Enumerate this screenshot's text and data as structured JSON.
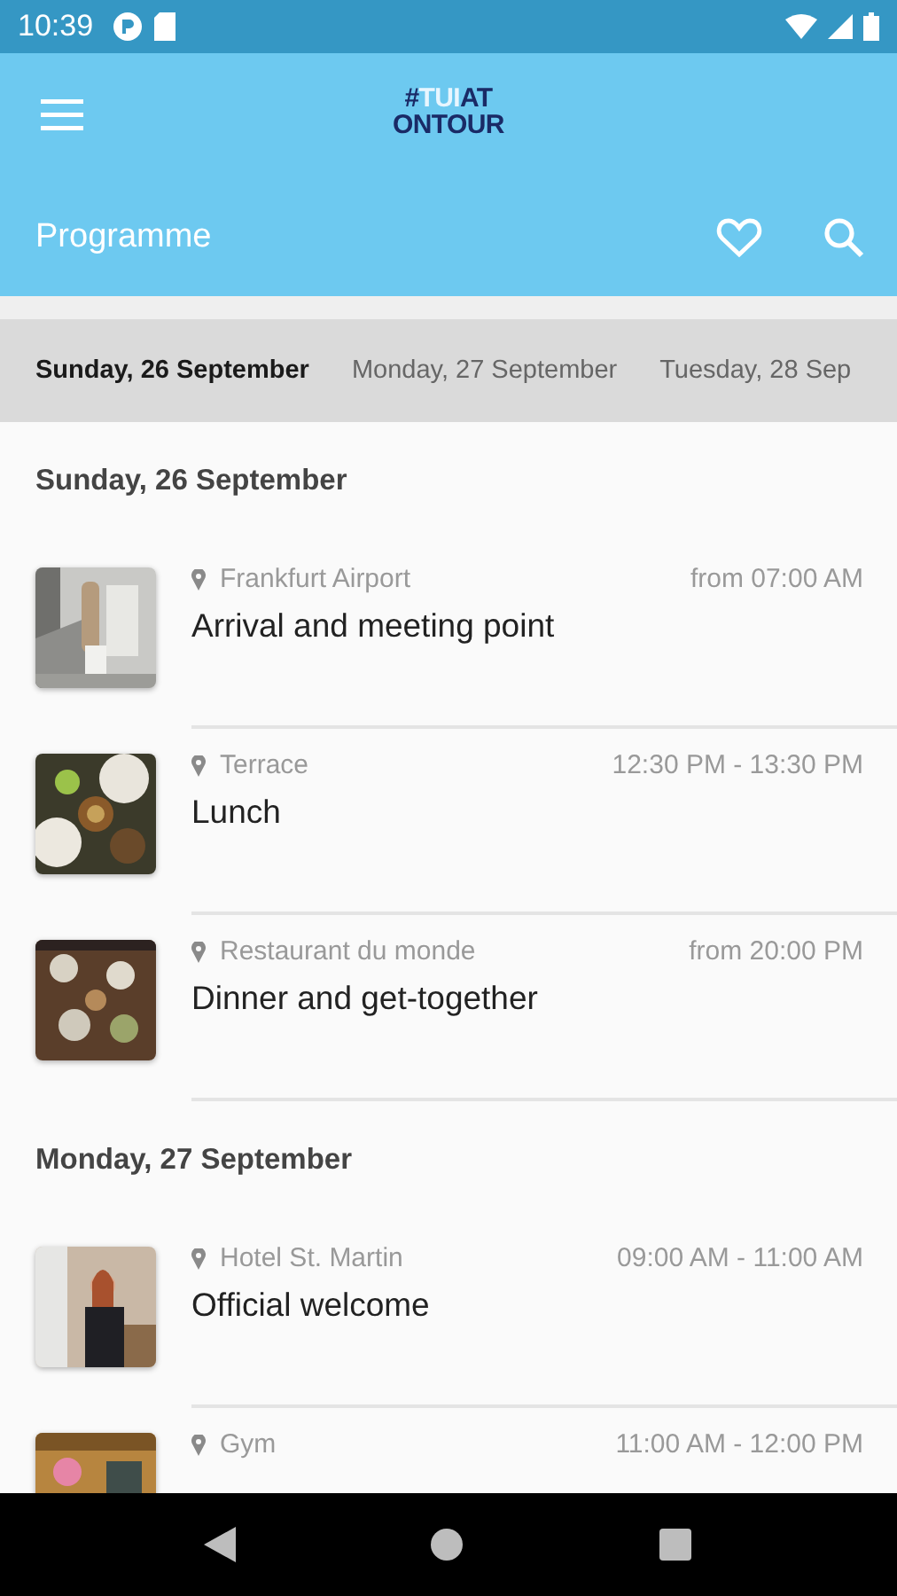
{
  "status_bar": {
    "time": "10:39"
  },
  "app_bar": {
    "logo": {
      "line1": [
        {
          "text": "#",
          "highlight": false
        },
        {
          "text": "TUI",
          "highlight": true
        },
        {
          "text": "AT",
          "highlight": false
        }
      ],
      "line2": "ONTOUR"
    }
  },
  "title_bar": {
    "title": "Programme"
  },
  "day_tabs": [
    {
      "label": "Sunday, 26 September",
      "selected": true
    },
    {
      "label": "Monday, 27 September",
      "selected": false
    },
    {
      "label": "Tuesday, 28 Sep",
      "selected": false
    }
  ],
  "sections": [
    {
      "heading": "Sunday, 26 September",
      "events": [
        {
          "location": "Frankfurt Airport",
          "time": "from 07:00 AM",
          "title": "Arrival and meeting point"
        },
        {
          "location": "Terrace",
          "time": "12:30 PM - 13:30 PM",
          "title": "Lunch"
        },
        {
          "location": "Restaurant du monde",
          "time": "from 20:00 PM",
          "title": "Dinner and get-together"
        }
      ]
    },
    {
      "heading": "Monday, 27 September",
      "events": [
        {
          "location": "Hotel St. Martin",
          "time": "09:00 AM - 11:00 AM",
          "title": "Official welcome"
        },
        {
          "location": "Gym",
          "time": "11:00 AM - 12:00 PM"
        }
      ]
    }
  ]
}
